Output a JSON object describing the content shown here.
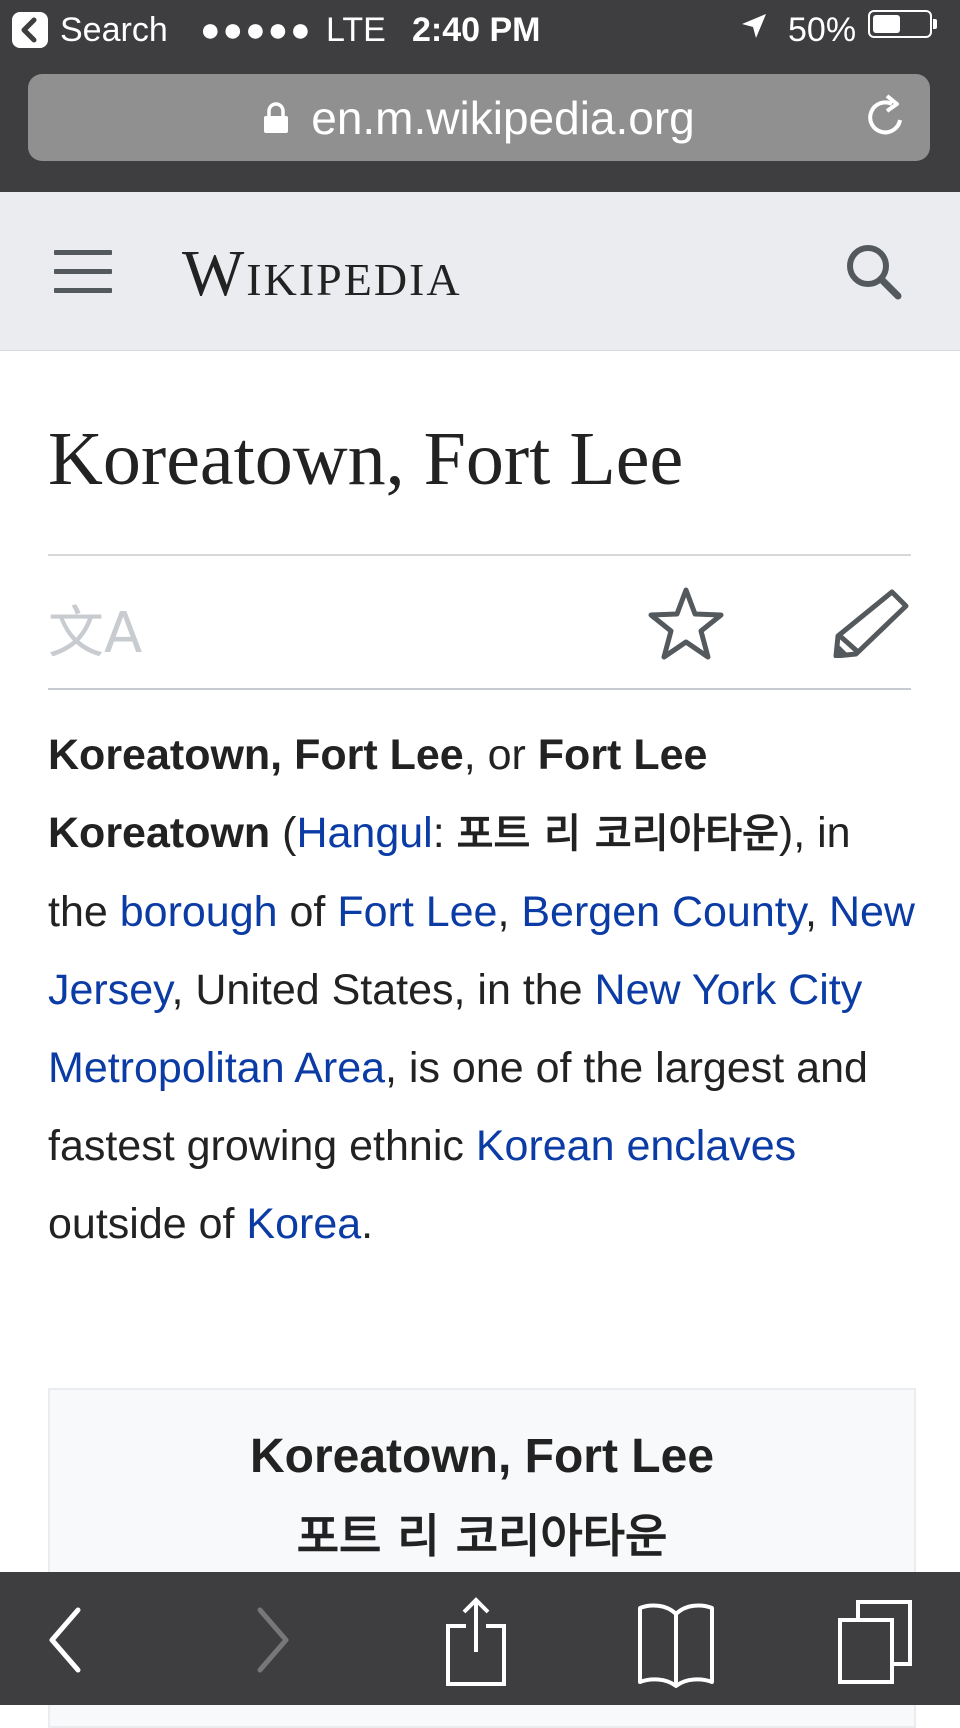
{
  "status_bar": {
    "back_app": "Search",
    "signal": "●●●●●",
    "carrier": "LTE",
    "time": "2:40 PM",
    "battery_pct": "50%",
    "battery_level": 0.5
  },
  "browser": {
    "url": "en.m.wikipedia.org"
  },
  "header": {
    "wordmark": "Wikipedia"
  },
  "article": {
    "title": "Koreatown, Fort Lee",
    "lead": {
      "b1": "Koreatown, Fort Lee",
      "t1": ", or ",
      "b2": "Fort Lee Koreatown",
      "t2": " (",
      "l_hangul": "Hangul",
      "t3": ": ",
      "hangul_b": "포트 리 코리아타운",
      "t4": "), in the ",
      "l_borough": "borough",
      "t5": " of ",
      "l_fortlee": "Fort Lee",
      "t6": ", ",
      "l_bergen": "Bergen County",
      "t7": ", ",
      "l_nj": "New Jersey",
      "t8": ", United States, in the ",
      "l_nyc": "New York City Metropolitan Area",
      "t9": ", is one of the largest and fastest growing ethnic ",
      "l_enclaves": "Korean enclaves",
      "t10": " outside of ",
      "l_korea": "Korea",
      "t11": "."
    },
    "infobox": {
      "title": "Koreatown, Fort Lee",
      "native_name": "포트 리 코리아타운"
    }
  },
  "icons": {
    "back_app": "back-arrow-icon",
    "location": "location-arrow-icon",
    "lock": "lock-icon",
    "reload": "reload-icon",
    "menu": "hamburger-menu-icon",
    "search": "search-icon",
    "language": "language-icon",
    "watch": "star-icon",
    "edit": "pencil-icon",
    "nav_back": "chevron-left-icon",
    "nav_forward": "chevron-right-icon",
    "share": "share-icon",
    "bookmarks": "book-icon",
    "tabs": "tabs-icon"
  },
  "colors": {
    "link": "#0b3ba5",
    "chrome": "#3e3e40",
    "header_bg": "#eaecf0"
  }
}
